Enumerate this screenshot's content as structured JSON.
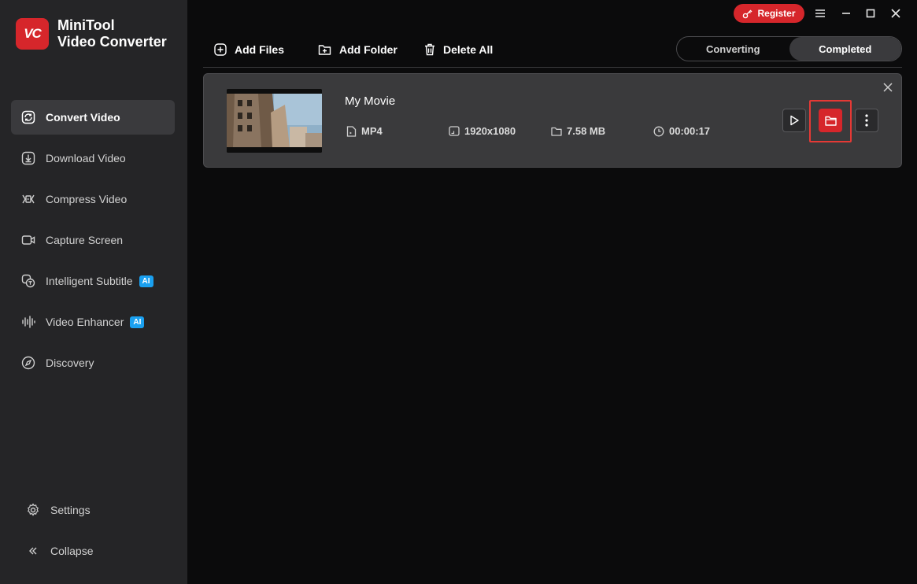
{
  "app": {
    "logo_initials": "VC",
    "name_line1": "MiniTool",
    "name_line2": "Video Converter"
  },
  "header": {
    "register_label": "Register"
  },
  "sidebar": {
    "items": [
      {
        "label": "Convert Video",
        "icon": "convert-icon",
        "active": true
      },
      {
        "label": "Download Video",
        "icon": "download-icon"
      },
      {
        "label": "Compress Video",
        "icon": "compress-icon"
      },
      {
        "label": "Capture Screen",
        "icon": "camera-icon"
      },
      {
        "label": "Intelligent Subtitle",
        "icon": "subtitle-icon",
        "badge": "AI"
      },
      {
        "label": "Video Enhancer",
        "icon": "waveform-icon",
        "badge": "AI"
      },
      {
        "label": "Discovery",
        "icon": "compass-icon"
      }
    ],
    "settings_label": "Settings",
    "collapse_label": "Collapse"
  },
  "toolbar": {
    "add_files": "Add Files",
    "add_folder": "Add Folder",
    "delete_all": "Delete All"
  },
  "tabs": {
    "converting": "Converting",
    "completed": "Completed",
    "active": "completed"
  },
  "file": {
    "title": "My Movie",
    "format": "MP4",
    "resolution": "1920x1080",
    "size": "7.58 MB",
    "duration": "00:00:17"
  },
  "colors": {
    "accent": "#d6262b",
    "ai_badge": "#1aa0f0",
    "sidebar_bg": "#252527",
    "main_bg": "#0b0b0c"
  }
}
